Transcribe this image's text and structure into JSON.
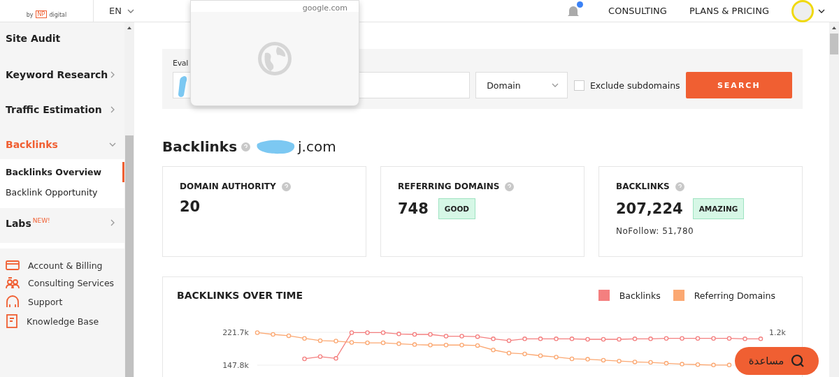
{
  "header": {
    "logo": {
      "by": "by",
      "mark": "NP",
      "name": "digital"
    },
    "language": "EN",
    "notifications": {
      "unread": true
    },
    "nav": [
      "CONSULTING",
      "PLANS & PRICING"
    ]
  },
  "sidebar": {
    "items": [
      {
        "label": "Site Audit",
        "selected": false
      },
      {
        "label": "Keyword Research",
        "selected": false,
        "expanded": false
      },
      {
        "label": "Traffic Estimation",
        "selected": false,
        "expanded": false
      },
      {
        "label": "Backlinks",
        "selected": true,
        "expanded": true,
        "children": [
          {
            "label": "Backlinks Overview",
            "selected": true
          },
          {
            "label": "Backlink Opportunity",
            "selected": false
          }
        ]
      },
      {
        "label": "Labs",
        "badge": "NEW!",
        "selected": false,
        "expanded": false
      }
    ],
    "links": [
      {
        "kind": "card",
        "label": "Account & Billing"
      },
      {
        "kind": "people",
        "label": "Consulting Services"
      },
      {
        "kind": "headset",
        "label": "Support"
      },
      {
        "kind": "doc",
        "label": "Knowledge Base"
      }
    ]
  },
  "search": {
    "label": "Eval",
    "type": "Domain",
    "exclude_subdomains": false,
    "checkbox_label": "Exclude subdomains",
    "button": "SEARCH"
  },
  "suggestion_popup": {
    "domain": "google.com"
  },
  "overview": {
    "title": "Backlinks",
    "domain": "j.com",
    "cards": [
      {
        "title": "DOMAIN AUTHORITY",
        "value": "20"
      },
      {
        "title": "REFERRING DOMAINS",
        "value": "748",
        "badge": "GOOD"
      },
      {
        "title": "BACKLINKS",
        "value": "207,224",
        "badge": "AMAZING",
        "note": "NoFollow: 51,780"
      }
    ]
  },
  "chart": {
    "title": "BACKLINKS OVER TIME",
    "chart_data": {
      "type": "line",
      "ylim": [
        147.8,
        221.7
      ],
      "yticks": [
        {
          "value": 221.7,
          "label": "221.7k"
        },
        {
          "value": 147.8,
          "label": "147.8k"
        }
      ],
      "series": [
        {
          "name": "Backlinks",
          "color": "#f47f7f",
          "marker": "circle",
          "values": [
            null,
            null,
            null,
            162,
            167,
            163,
            221,
            221,
            221,
            218,
            217,
            217,
            213,
            213,
            212,
            207,
            203,
            207,
            207,
            207,
            207,
            206,
            206,
            206,
            207,
            207,
            208,
            208,
            208,
            208,
            208,
            207,
            207
          ]
        },
        {
          "name": "Referring Domains",
          "color": "#fba872",
          "marker": "circle",
          "values": [
            221,
            217,
            214,
            208,
            203,
            202,
            199,
            198,
            198,
            196,
            194,
            193,
            193,
            193,
            192,
            182,
            175,
            173,
            169,
            166,
            162,
            161,
            159,
            157,
            155,
            154,
            152,
            150,
            149,
            148,
            148,
            null,
            null
          ]
        }
      ]
    },
    "right_axis_label": "1.2k"
  },
  "help_button": {
    "label": "مساعدة"
  }
}
